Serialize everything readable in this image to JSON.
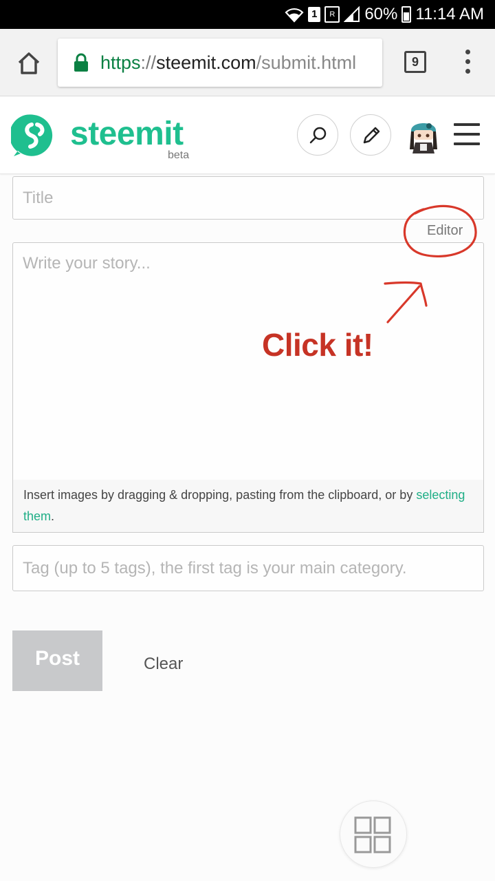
{
  "status_bar": {
    "sim_badge": "1",
    "network_label": "R",
    "battery_percent": "60%",
    "time": "11:14 AM",
    "icons": [
      "wifi-icon",
      "signal-icon",
      "battery-icon"
    ]
  },
  "browser": {
    "url_scheme": "https",
    "url_separator": "://",
    "url_host": "steemit.com",
    "url_path": "/submit.html",
    "tab_count": "9",
    "icons": [
      "home-icon",
      "lock-icon",
      "tabs-icon",
      "more-vert-icon"
    ]
  },
  "site": {
    "logo_text": "steemit",
    "logo_tag": "beta",
    "brand_color": "#1fbf8f",
    "icons": [
      "search-icon",
      "pencil-icon",
      "avatar",
      "hamburger-icon"
    ]
  },
  "form": {
    "title_placeholder": "Title",
    "editor_toggle": "Editor",
    "story_placeholder": "Write your story...",
    "drop_hint_prefix": "Insert images by dragging & dropping, pasting from the clipboard, or by ",
    "drop_hint_link": "selecting them",
    "drop_hint_suffix": ".",
    "tag_placeholder": "Tag (up to 5 tags), the first tag is your main category.",
    "post_label": "Post",
    "clear_label": "Clear"
  },
  "annotation": {
    "text": "Click it!",
    "color": "#d8382a"
  },
  "fab_icon": "grid-icon"
}
